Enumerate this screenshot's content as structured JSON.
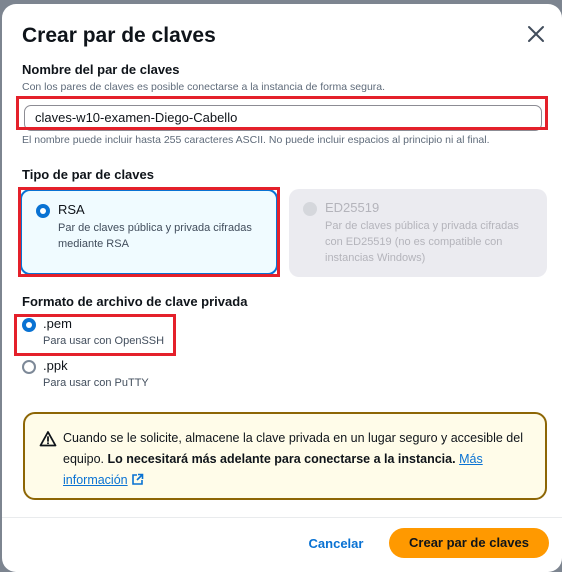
{
  "dialog": {
    "title": "Crear par de claves",
    "close_icon": "close-icon"
  },
  "key_name": {
    "label": "Nombre del par de claves",
    "description": "Con los pares de claves es posible conectarse a la instancia de forma segura.",
    "value": "claves-w10-examen-Diego-Cabello",
    "constraint": "El nombre puede incluir hasta 255 caracteres ASCII. No puede incluir espacios al principio ni al final."
  },
  "key_type": {
    "label": "Tipo de par de claves",
    "options": [
      {
        "title": "RSA",
        "description": "Par de claves pública y privada cifradas mediante RSA",
        "selected": true,
        "disabled": false
      },
      {
        "title": "ED25519",
        "description": "Par de claves pública y privada cifradas con ED25519 (no es compatible con instancias Windows)",
        "selected": false,
        "disabled": true
      }
    ]
  },
  "file_format": {
    "label": "Formato de archivo de clave privada",
    "options": [
      {
        "title": ".pem",
        "description": "Para usar con OpenSSH",
        "selected": true
      },
      {
        "title": ".ppk",
        "description": "Para usar con PuTTY",
        "selected": false
      }
    ]
  },
  "warning": {
    "icon": "warning-icon",
    "text_1": "Cuando se le solicite, almacene la clave privada en un lugar seguro y accesible del equipo.",
    "text_bold": "Lo necesitará más adelante para conectarse a la instancia.",
    "link_text": "Más información",
    "link_icon": "external-link-icon"
  },
  "footer": {
    "cancel_label": "Cancelar",
    "create_label": "Crear par de claves"
  },
  "colors": {
    "accent": "#0972d3",
    "primary_button": "#ff9900",
    "highlight_box": "#e4202a",
    "warning_border": "#8d6605"
  }
}
